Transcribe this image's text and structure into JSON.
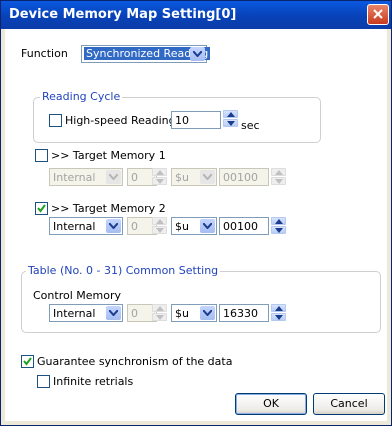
{
  "window": {
    "title": "Device Memory Map Setting[0]"
  },
  "function": {
    "label": "Function",
    "value": "Synchronized Reading"
  },
  "reading_cycle": {
    "group_label": "Reading Cycle",
    "highspeed_label": "High-speed Reading",
    "highspeed_checked": false,
    "cycle_value": "10",
    "unit": "sec"
  },
  "target1": {
    "label": ">> Target Memory 1",
    "checked": false,
    "device": "Internal",
    "station": "0",
    "type": "$u",
    "address": "00100"
  },
  "target2": {
    "label": ">> Target Memory 2",
    "checked": true,
    "device": "Internal",
    "station": "0",
    "type": "$u",
    "address": "00100"
  },
  "table": {
    "group_label": "Table (No. 0 - 31) Common Setting",
    "control_label": "Control Memory",
    "device": "Internal",
    "station": "0",
    "type": "$u",
    "address": "16330"
  },
  "guarantee": {
    "label": "Guarantee synchronism of the data",
    "checked": true
  },
  "infinite": {
    "label": "Infinite retrials",
    "checked": false
  },
  "buttons": {
    "ok": "OK",
    "cancel": "Cancel"
  }
}
